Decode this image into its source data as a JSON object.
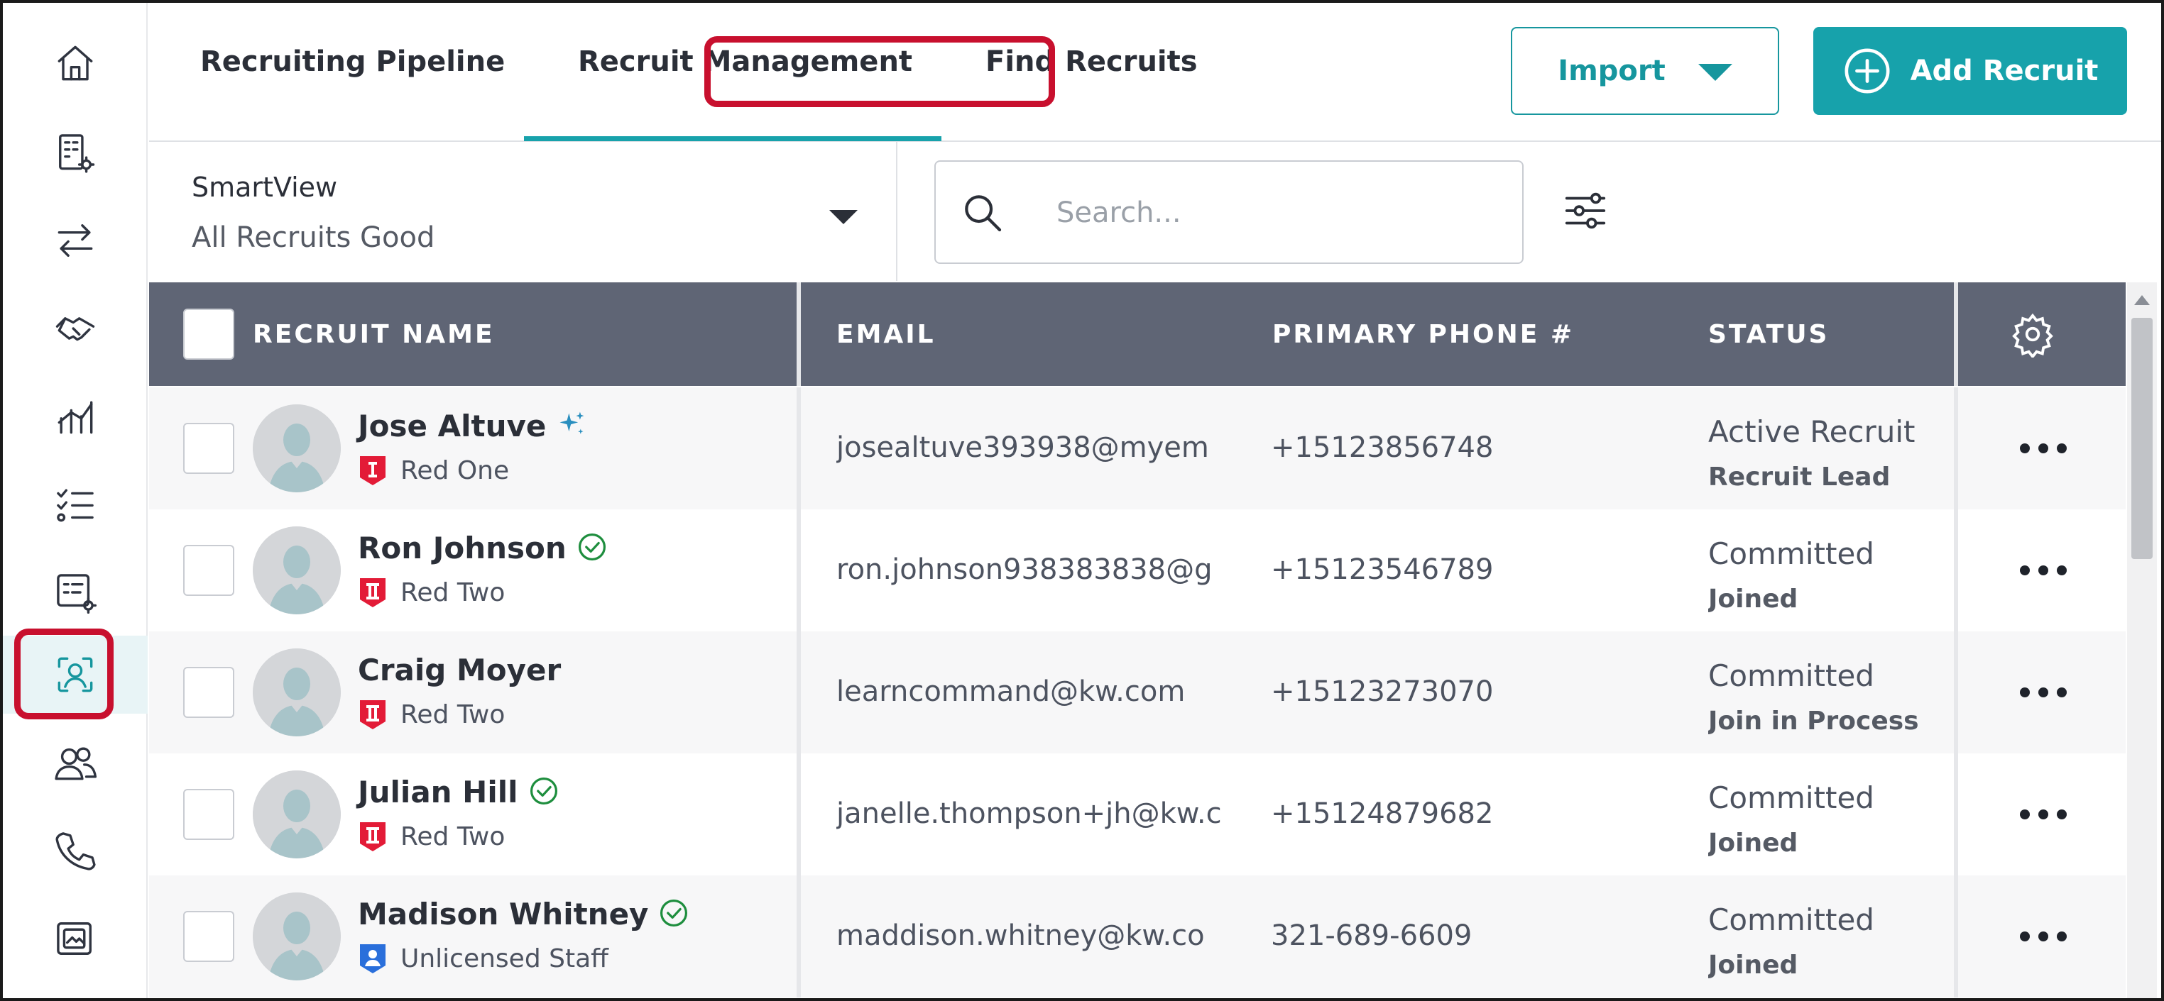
{
  "tabs": {
    "pipeline": "Recruiting Pipeline",
    "management": "Recruit Management",
    "find": "Find Recruits",
    "active": "Recruit Management"
  },
  "actions": {
    "import_label": "Import",
    "add_label": "Add Recruit"
  },
  "smartview": {
    "label": "SmartView",
    "value": "All Recruits Good"
  },
  "search": {
    "placeholder": "Search..."
  },
  "table": {
    "columns": {
      "name": "RECRUIT NAME",
      "email": "EMAIL",
      "phone": "PRIMARY PHONE #",
      "status": "STATUS"
    },
    "rows": [
      {
        "name": "Jose Altuve",
        "name_icon": "sparkle-icon",
        "team": "Red One",
        "team_icon": "red-one-badge-icon",
        "email": "josealtuve393938@myem",
        "phone": "+15123856748",
        "status": "Active Recruit",
        "substatus": "Recruit Lead"
      },
      {
        "name": "Ron Johnson",
        "name_icon": "verified-check-icon",
        "team": "Red Two",
        "team_icon": "red-two-badge-icon",
        "email": "ron.johnson938383838@g",
        "phone": "+15123546789",
        "status": "Committed",
        "substatus": "Joined"
      },
      {
        "name": "Craig Moyer",
        "name_icon": "",
        "team": "Red Two",
        "team_icon": "red-two-badge-icon",
        "email": "learncommand@kw.com",
        "phone": "+15123273070",
        "status": "Committed",
        "substatus": "Join in Process"
      },
      {
        "name": "Julian Hill",
        "name_icon": "verified-check-icon",
        "team": "Red Two",
        "team_icon": "red-two-badge-icon",
        "email": "janelle.thompson+jh@kw.c",
        "phone": "+15124879682",
        "status": "Committed",
        "substatus": "Joined"
      },
      {
        "name": "Madison Whitney",
        "name_icon": "verified-check-icon",
        "team": "Unlicensed Staff",
        "team_icon": "unlicensed-staff-badge-icon",
        "email": "maddison.whitney@kw.co",
        "phone": "321-689-6609",
        "status": "Committed",
        "substatus": "Joined"
      }
    ]
  },
  "sidebar": {
    "icons": [
      "home-icon",
      "building-settings-icon",
      "transfer-arrows-icon",
      "handshake-icon",
      "analytics-icon",
      "checklist-icon",
      "form-settings-icon",
      "recruit-profile-icon",
      "team-icon",
      "phone-icon",
      "gallery-icon"
    ],
    "active": "recruit-profile-icon"
  },
  "colors": {
    "accent": "#17a2ab",
    "header_bg": "#5f6575",
    "highlight": "#c8102e",
    "badge_red": "#e31b37",
    "badge_blue": "#2a6fdb",
    "check_green": "#1e8e3e"
  }
}
